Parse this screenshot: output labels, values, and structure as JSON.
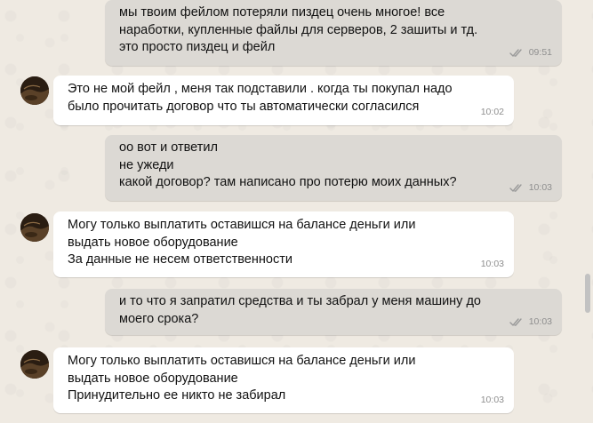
{
  "messages": [
    {
      "direction": "out",
      "lines": [
        "мы твоим фейлом потеряли пиздец очень многое! все",
        "наработки, купленные файлы для серверов, 2 зашиты и тд.",
        "это просто пиздец и фейл"
      ],
      "time": "09:51",
      "read_ticks": "double-check-icon"
    },
    {
      "direction": "in",
      "lines": [
        "Это не мой фейл , меня так подставили . когда ты покупал надо",
        "было прочитать договор что ты автоматически согласился"
      ],
      "time": "10:02"
    },
    {
      "direction": "out",
      "lines": [
        "оо вот и ответил",
        "не ужеди",
        "какой договор? там написано про потерю моих данных?"
      ],
      "time": "10:03",
      "read_ticks": "double-check-icon"
    },
    {
      "direction": "in",
      "lines": [
        "Могу только выплатить оставишся на балансе деньги или",
        "выдать новое оборудование",
        "За данные не несем ответственности"
      ],
      "time": "10:03"
    },
    {
      "direction": "out",
      "lines": [
        "и то что я запратил средства и ты забрал у меня машину до",
        "моего срока?"
      ],
      "time": "10:03",
      "read_ticks": "double-check-icon"
    },
    {
      "direction": "in",
      "lines": [
        "Могу только выплатить оставишся на балансе деньги или",
        "выдать новое оборудование",
        "Принудительно ее никто не забирал"
      ],
      "time": "10:03"
    }
  ],
  "colors": {
    "background": "#efeae2",
    "outgoing_bubble": "#dcd9d4",
    "incoming_bubble": "#ffffff",
    "timestamp": "#8e8e8e"
  }
}
